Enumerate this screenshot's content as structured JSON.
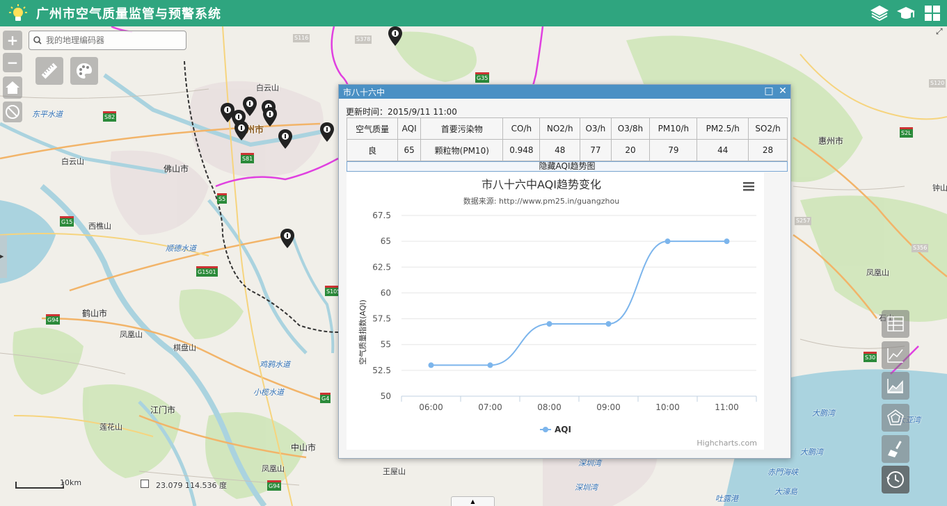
{
  "app": {
    "title": "广州市空气质量监管与预警系统"
  },
  "header_icons": [
    "layers-icon",
    "graduation-cap-icon",
    "grid-icon"
  ],
  "search": {
    "placeholder": "我的地理编码器"
  },
  "map_labels": {
    "guangzhou": "广州市",
    "foshan": "佛山市",
    "huizhou": "惠州市",
    "heshan": "鹤山市",
    "jiangmen": "江门市",
    "zhongshan": "中山市",
    "baiyunshan": "白云山",
    "baiyunshan2": "白云山",
    "xiqiaoshan": "西樵山",
    "fenghuangshan": "凤凰山",
    "fenghuangshan2": "凤凰山",
    "fenghuangshan3": "凤凰山",
    "qipanshan": "棋盘山",
    "lianhuashan": "莲花山",
    "wangwushan": "王屋山",
    "dongpingshuidao": "东平水道",
    "shundeshuidao": "顺德水道",
    "jiyashuidao": "鸡鸦水道",
    "xiaolanshuidao": "小榄水道",
    "shenzhenwan": "深圳湾",
    "shenzhenwan2": "深圳湾",
    "dapengwan": "大鹏湾",
    "dapengwan2": "大鹏湾",
    "dayawan": "大亚湾",
    "chimenhaixia": "赤門海峡",
    "dahaodao": "大濠島",
    "tulugang": "吐露港",
    "shishan": "石山",
    "zhongshan2": "钟山"
  },
  "scale": {
    "label": "10km"
  },
  "coords": {
    "text": "23.079  114.536 度"
  },
  "popup": {
    "title": "市八十六中",
    "updated_label": "更新时间：2015/9/11 11:00",
    "headers": [
      "空气质量",
      "AQI",
      "首要污染物",
      "CO/h",
      "NO2/h",
      "O3/h",
      "O3/8h",
      "PM10/h",
      "PM2.5/h",
      "SO2/h"
    ],
    "values": [
      "良",
      "65",
      "颗粒物(PM10)",
      "0.948",
      "48",
      "77",
      "20",
      "79",
      "44",
      "28"
    ],
    "toggle_label": "隐藏AQI趋势图"
  },
  "chart_data": {
    "type": "line",
    "title": "市八十六中AQI趋势变化",
    "subtitle": "数据来源: http://www.pm25.in/guangzhou",
    "ylabel": "空气质量指数(AQI)",
    "categories": [
      "06:00",
      "07:00",
      "08:00",
      "09:00",
      "10:00",
      "11:00"
    ],
    "series": [
      {
        "name": "AQI",
        "values": [
          53,
          53,
          57,
          57,
          65,
          65
        ]
      }
    ],
    "ylim": [
      50,
      67.5
    ],
    "yticks": [
      "50",
      "52.5",
      "55",
      "57.5",
      "60",
      "62.5",
      "65",
      "67.5"
    ],
    "credits": "Highcharts.com",
    "legend": "bottom-center",
    "color": "#7cb5ec"
  }
}
